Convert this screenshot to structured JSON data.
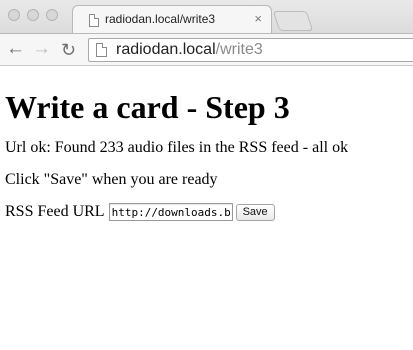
{
  "browser": {
    "tab": {
      "title": "radiodan.local/write3",
      "close_glyph": "×"
    },
    "toolbar": {
      "back_glyph": "←",
      "forward_glyph": "→",
      "reload_glyph": "↻"
    },
    "address": {
      "host": "radiodan.local",
      "path": "/write3"
    }
  },
  "page": {
    "heading": "Write a card - Step 3",
    "status_text": "Url ok: Found 233 audio files in the RSS feed - all ok",
    "hint_text": "Click \"Save\" when you are ready",
    "form": {
      "label": "RSS Feed URL",
      "input_value": "http://downloads.bbc",
      "save_label": "Save"
    }
  }
}
